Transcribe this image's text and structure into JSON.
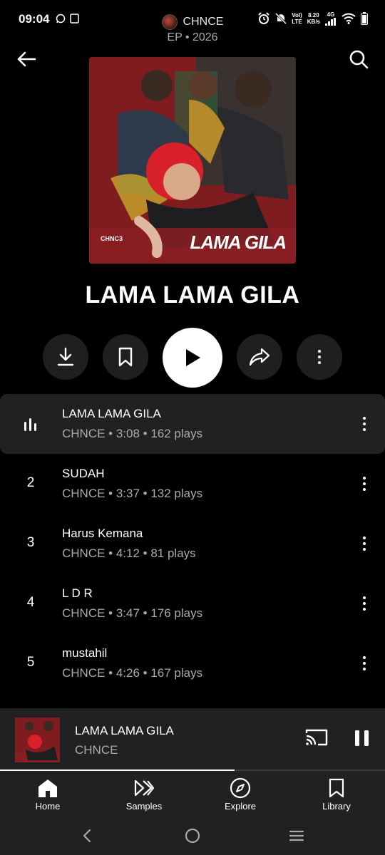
{
  "status_bar": {
    "time": "09:04",
    "net_speed_value": "8.20",
    "net_speed_unit": "KB/s",
    "volte_top": "Vol)",
    "volte_bottom": "LTE",
    "network": "4G"
  },
  "header": {
    "artist": "CHNCE",
    "subtitle": "EP • 2026"
  },
  "album_art": {
    "art_title": "LAMA GILA",
    "brand": "CHNC3"
  },
  "album": {
    "title": "LAMA LAMA GILA"
  },
  "tracks": [
    {
      "index": "",
      "title": "LAMA LAMA GILA",
      "meta": "CHNCE • 3:08 • 162 plays",
      "playing": true
    },
    {
      "index": "2",
      "title": "SUDAH",
      "meta": "CHNCE • 3:37 • 132 plays",
      "playing": false
    },
    {
      "index": "3",
      "title": "Harus Kemana",
      "meta": "CHNCE • 4:12 • 81 plays",
      "playing": false
    },
    {
      "index": "4",
      "title": "L D R",
      "meta": "CHNCE • 3:47 • 176 plays",
      "playing": false
    },
    {
      "index": "5",
      "title": "mustahil",
      "meta": "CHNCE • 4:26 • 167 plays",
      "playing": false
    }
  ],
  "mini_player": {
    "title": "LAMA LAMA GILA",
    "artist": "CHNCE",
    "progress_fraction": 0.61
  },
  "bottom_nav": [
    {
      "label": "Home",
      "icon": "home-icon",
      "active": true
    },
    {
      "label": "Samples",
      "icon": "samples-icon",
      "active": false
    },
    {
      "label": "Explore",
      "icon": "compass-icon",
      "active": false
    },
    {
      "label": "Library",
      "icon": "library-icon",
      "active": false
    }
  ],
  "colors": {
    "background": "#000000",
    "surface": "#212121",
    "button_surface": "#1f1f1f",
    "secondary_text": "#aaaaaa",
    "accent": "#ffffff"
  }
}
